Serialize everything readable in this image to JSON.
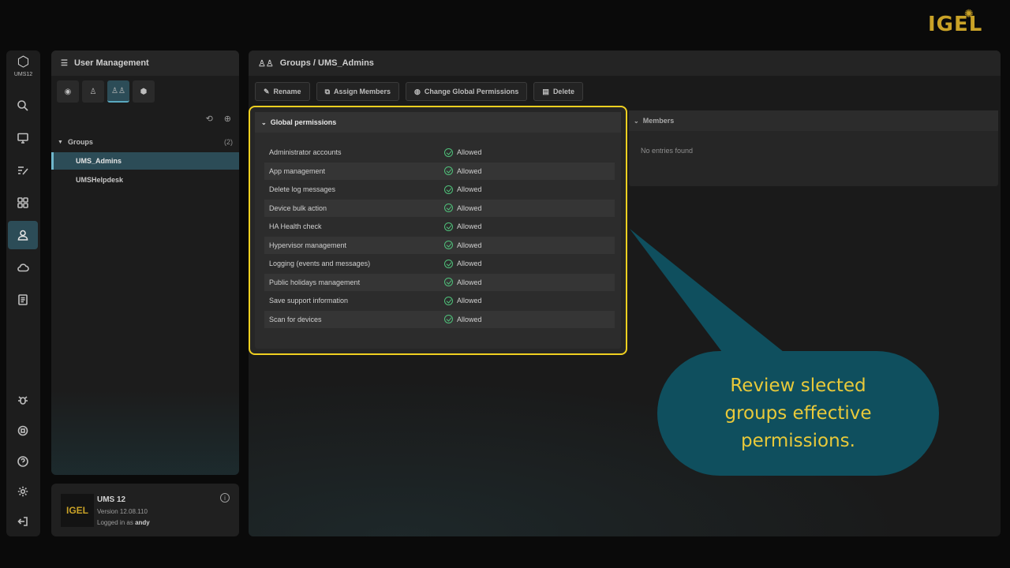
{
  "brand": {
    "top_logo": "IGEL",
    "rail_logo_text": "UMS12",
    "card_logo": "IGEL"
  },
  "left_panel": {
    "title": "User Management",
    "tree": {
      "header": "Groups",
      "count": "(2)",
      "items": [
        {
          "label": "UMS_Admins",
          "selected": true
        },
        {
          "label": "UMSHelpdesk",
          "selected": false
        }
      ]
    }
  },
  "info_card": {
    "product": "UMS 12",
    "version": "Version 12.08.110",
    "logged_in_prefix": "Logged in as",
    "user": "andy"
  },
  "main": {
    "breadcrumb": "Groups / UMS_Admins",
    "toolbar": {
      "rename": "Rename",
      "assign_members": "Assign Members",
      "change_global_permissions": "Change Global Permissions",
      "delete": "Delete"
    },
    "global_permissions": {
      "title": "Global permissions",
      "rows": [
        {
          "name": "Administrator accounts",
          "status": "Allowed"
        },
        {
          "name": "App management",
          "status": "Allowed"
        },
        {
          "name": "Delete log messages",
          "status": "Allowed"
        },
        {
          "name": "Device bulk action",
          "status": "Allowed"
        },
        {
          "name": "HA Health check",
          "status": "Allowed"
        },
        {
          "name": "Hypervisor management",
          "status": "Allowed"
        },
        {
          "name": "Logging (events and messages)",
          "status": "Allowed"
        },
        {
          "name": "Public holidays management",
          "status": "Allowed"
        },
        {
          "name": "Save support information",
          "status": "Allowed"
        },
        {
          "name": "Scan for devices",
          "status": "Allowed"
        }
      ]
    },
    "members": {
      "title": "Members",
      "empty_text": "No entries found"
    }
  },
  "callout": {
    "text_line1": "Review slected",
    "text_line2": "groups effective",
    "text_line3": "permissions."
  },
  "colors": {
    "accent": "#2c4c57",
    "highlight": "#f0d020",
    "callout_bg": "#0f4f5e",
    "callout_text": "#e8c93a",
    "allowed": "#4fc07a",
    "brand": "#c9a227"
  }
}
